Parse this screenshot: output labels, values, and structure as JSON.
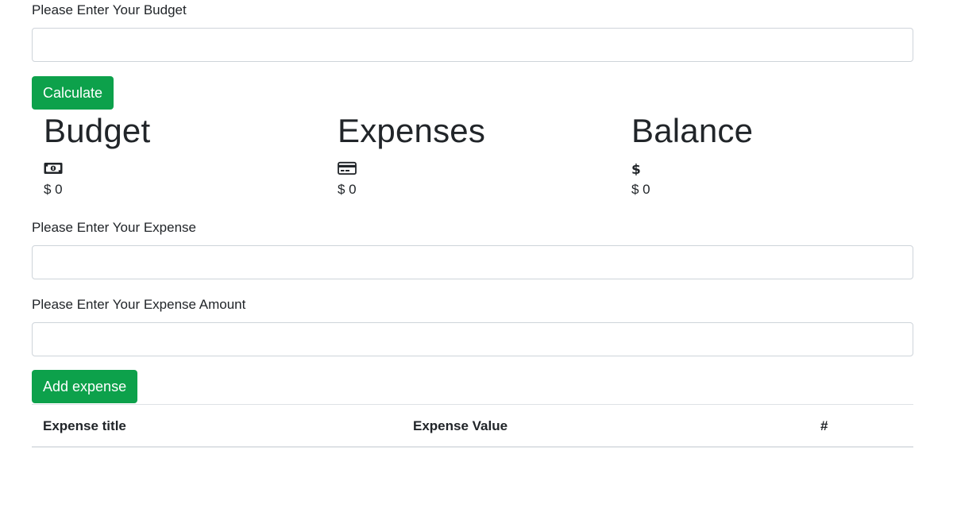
{
  "budget_form": {
    "label": "Please Enter Your Budget",
    "input_value": "",
    "button_label": "Calculate",
    "button_color": "#0da14b"
  },
  "summary": {
    "budget": {
      "title": "Budget",
      "icon": "money-bill-icon",
      "amount": "$ 0"
    },
    "expenses": {
      "title": "Expenses",
      "icon": "credit-card-icon",
      "amount": "$ 0"
    },
    "balance": {
      "title": "Balance",
      "icon": "dollar-sign-icon",
      "amount": "$ 0"
    }
  },
  "expense_form": {
    "title_label": "Please Enter Your Expense",
    "title_value": "",
    "amount_label": "Please Enter Your Expense Amount",
    "amount_value": "",
    "button_label": "Add expense",
    "button_color": "#0da14b"
  },
  "expense_table": {
    "columns": [
      "Expense title",
      "Expense Value",
      "#"
    ],
    "rows": []
  }
}
